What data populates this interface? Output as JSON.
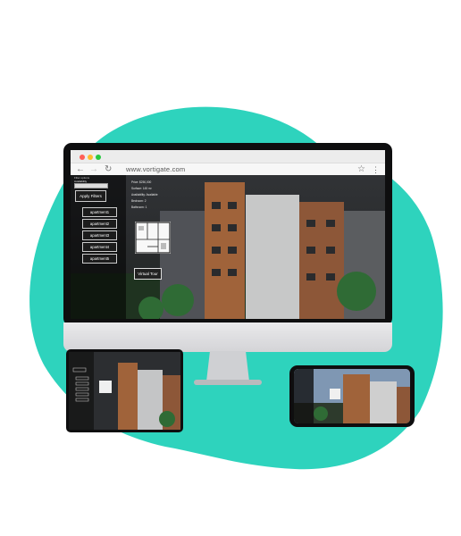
{
  "browser": {
    "url": "www.vortigate.com",
    "back_icon": "arrow-left-icon",
    "forward_icon": "arrow-right-icon",
    "reload_icon": "reload-icon",
    "bookmark_icon": "star-icon",
    "menu_icon": "kebab-icon"
  },
  "sidebar": {
    "filter_title": "Filter options",
    "availability_label": "Availability",
    "apply_label": "Apply Filters",
    "apartments": [
      "apartment1",
      "apartment2",
      "apartment3",
      "apartment4",
      "apartment5"
    ]
  },
  "details": {
    "price": "Price: $250,000",
    "surface": "Surface: 145 m²",
    "availability": "Availability: Available",
    "bedrooms": "Bedroom: 2",
    "bathrooms": "Bathroom: 1"
  },
  "tour_button": "Virtual Tour",
  "colors": {
    "blob": "#2ed3bd",
    "brick": "#a0633a",
    "frame": "#0e0e0f"
  }
}
